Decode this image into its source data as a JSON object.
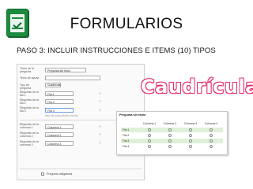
{
  "slide": {
    "title": "FORMULARIOS",
    "subtitle": "PASO 3: INCLUIR INSTRUCCIONES E ITEMS (10) TIPOS",
    "highlight": "Caudrícula",
    "logo_icon": "google-forms-icon"
  },
  "editor": {
    "question_title_label": "Título de la pregunta",
    "question_title_value": "Pregunta sin título",
    "help_text_label": "Texto de ayuda",
    "type_label": "Tipo de pregunta",
    "type_value": "Cuadrícula",
    "row_labels": [
      "Etiquetas de la fila 1",
      "Etiquetas de la fila 2",
      "Etiquetas de la fila 3"
    ],
    "rows": [
      "Fila 1",
      "Fila 2",
      "Fila 3"
    ],
    "add_row": "Haz clic para añadir una fila",
    "col_labels": [
      "Etiquetas de la columna 1",
      "Etiquetas de la columna 2",
      "Etiquetas de la columna 3"
    ],
    "columns": [
      "Columna 1",
      "Columna 2",
      "Columna 3"
    ],
    "required": "Pregunta obligatoria"
  },
  "preview": {
    "title": "Pregunta sin título",
    "columns": [
      "Columna 1",
      "Columna 2",
      "Columna 3",
      "Columna 4"
    ],
    "rows": [
      "Fila 1",
      "Fila 2",
      "Fila 3",
      "Fila 4"
    ]
  }
}
